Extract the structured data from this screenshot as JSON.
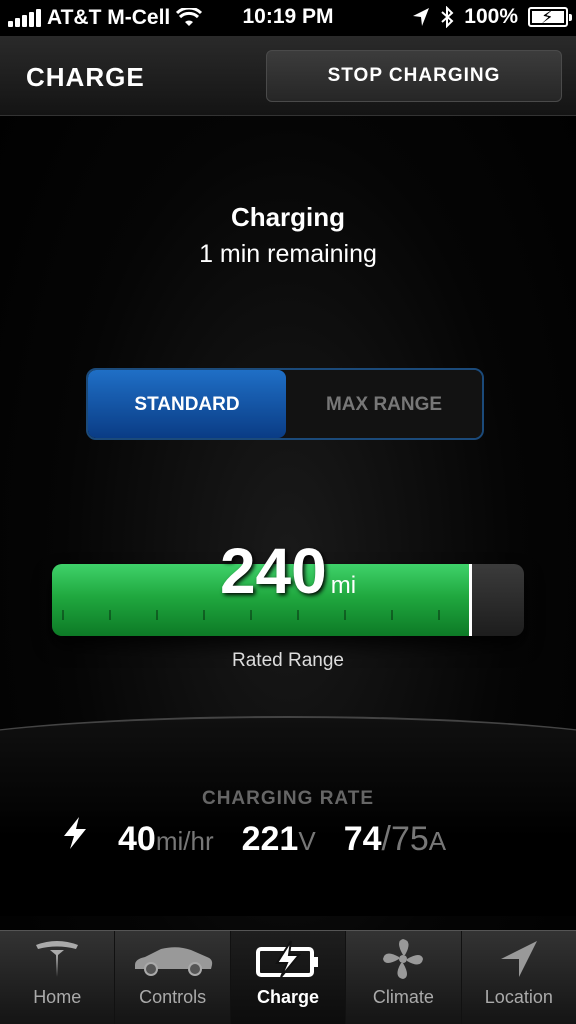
{
  "status_bar": {
    "carrier": "AT&T M-Cell",
    "time": "10:19 PM",
    "battery": "100%",
    "icons": [
      "signal-icon",
      "wifi-icon",
      "location-arrow-icon",
      "bluetooth-icon",
      "battery-icon"
    ]
  },
  "header": {
    "title": "CHARGE",
    "stop_button": "STOP CHARGING"
  },
  "status": {
    "title": "Charging",
    "subtitle": "1 min remaining"
  },
  "mode_toggle": {
    "options": [
      "STANDARD",
      "MAX RANGE"
    ],
    "selected": "STANDARD"
  },
  "range": {
    "value": "240",
    "unit": "mi",
    "label": "Rated Range",
    "fill_fraction": 0.89
  },
  "charging_rate": {
    "title": "CHARGING RATE",
    "speed_value": "40",
    "speed_unit": "mi/hr",
    "voltage_value": "221",
    "voltage_unit": "V",
    "current_value": "74",
    "current_max": "/75",
    "current_unit": "A"
  },
  "tabs": [
    {
      "label": "Home",
      "icon": "tesla-logo-icon"
    },
    {
      "label": "Controls",
      "icon": "car-icon"
    },
    {
      "label": "Charge",
      "icon": "battery-charge-icon",
      "active": true
    },
    {
      "label": "Climate",
      "icon": "fan-icon"
    },
    {
      "label": "Location",
      "icon": "navigation-arrow-icon"
    }
  ],
  "colors": {
    "accent_blue": "#0a3c85",
    "range_green": "#20a83f"
  }
}
